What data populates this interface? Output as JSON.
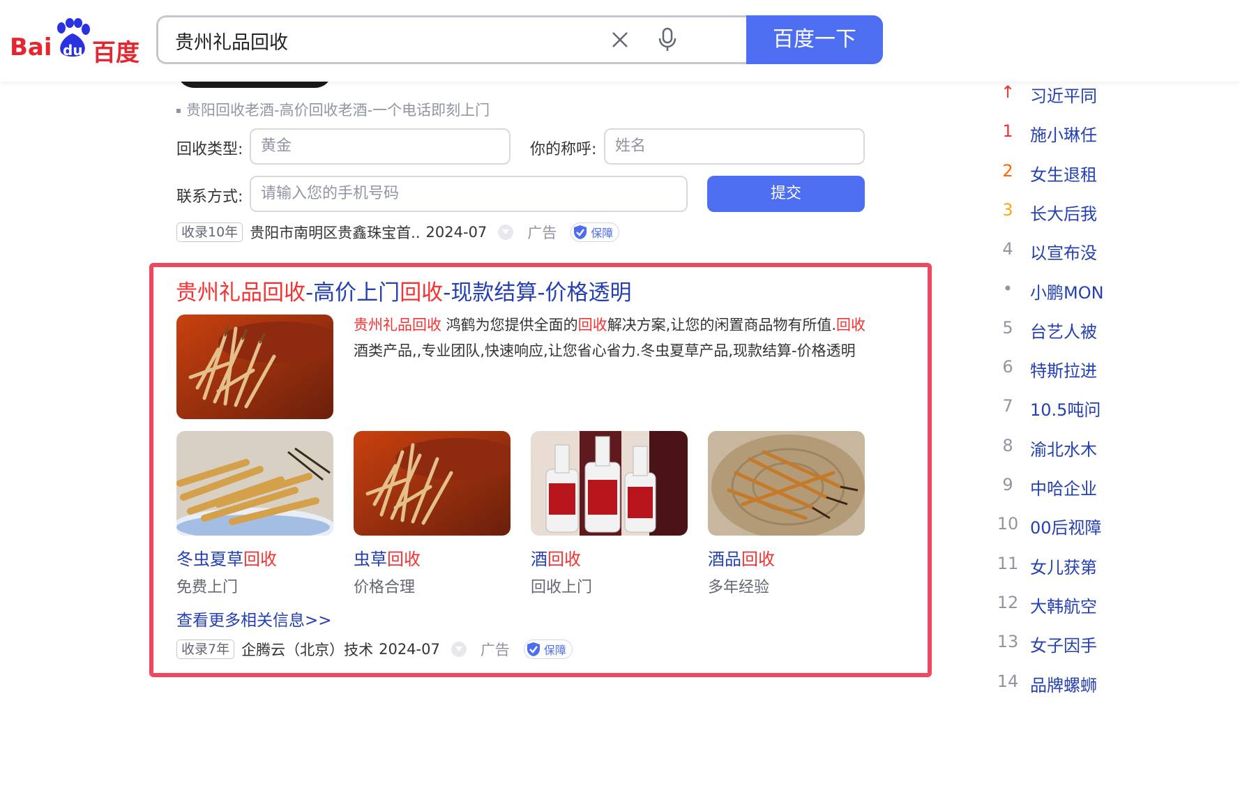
{
  "header": {
    "logo_text_left": "Bai",
    "logo_text_mid": "du",
    "logo_text_right": "百度",
    "search_query": "贵州礼品回收",
    "search_button": "百度一下"
  },
  "prev_ad": {
    "sub_link": "贵阳回收老酒-高价回收老酒-一个电话即刻上门",
    "form": {
      "type_label": "回收类型:",
      "type_value": "黄金",
      "name_label": "你的称呼:",
      "name_placeholder": "姓名",
      "contact_label": "联系方式:",
      "contact_placeholder": "请输入您的手机号码",
      "submit": "提交"
    },
    "meta": {
      "tag": "收录10年",
      "source": "贵阳市南明区贵鑫珠宝首..",
      "date": "2024-07",
      "ad": "广告",
      "guard": "保障"
    }
  },
  "ad_card": {
    "title_parts": [
      "贵州礼品回收",
      "-高价上门",
      "回收",
      "-现款结算-价格透明"
    ],
    "description_parts": [
      "贵州礼品回收",
      " 鸿鹤为您提供全面的",
      "回收",
      "解决方案,让您的闲置商品物有所值.",
      "回收",
      "酒类产品,,专业团队,快速响应,让您省心省力.冬虫夏草产品,现款结算-价格透明"
    ],
    "thumbs": [
      {
        "title_plain": "冬虫夏草",
        "title_hl": "回收",
        "subtitle": "免费上门"
      },
      {
        "title_plain": "虫草",
        "title_hl": "回收",
        "subtitle": "价格合理"
      },
      {
        "title_plain": "酒",
        "title_hl": "回收",
        "subtitle": "回收上门"
      },
      {
        "title_plain": "酒品",
        "title_hl": "回收",
        "subtitle": "多年经验"
      }
    ],
    "more_link": "查看更多相关信息>>",
    "meta": {
      "tag": "收录7年",
      "source": "企腾云（北京）技术",
      "date": "2024-07",
      "ad": "广告",
      "guard": "保障"
    },
    "highlight_color": "#f73131",
    "border_color": "#f0475f"
  },
  "hot_list": [
    {
      "rank": "↑",
      "text": "习近平同"
    },
    {
      "rank": "1",
      "text": "施小琳任"
    },
    {
      "rank": "2",
      "text": "女生退租"
    },
    {
      "rank": "3",
      "text": "长大后我"
    },
    {
      "rank": "4",
      "text": "以宣布没"
    },
    {
      "rank": "•",
      "text": "小鹏MON"
    },
    {
      "rank": "5",
      "text": "台艺人被"
    },
    {
      "rank": "6",
      "text": "特斯拉进"
    },
    {
      "rank": "7",
      "text": "10.5吨问"
    },
    {
      "rank": "8",
      "text": "渝北水木"
    },
    {
      "rank": "9",
      "text": "中哈企业"
    },
    {
      "rank": "10",
      "text": "00后视障"
    },
    {
      "rank": "11",
      "text": "女儿获第"
    },
    {
      "rank": "12",
      "text": "大韩航空"
    },
    {
      "rank": "13",
      "text": "女子因手"
    },
    {
      "rank": "14",
      "text": "品牌螺蛳"
    }
  ],
  "rank_colors": {
    "top": "#f73131",
    "first": "#f73131",
    "second": "#ff6600",
    "third": "#faa90e",
    "rest": "#9195a3"
  }
}
